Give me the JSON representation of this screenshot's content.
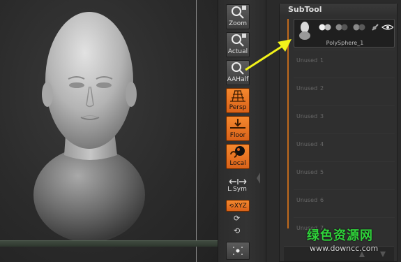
{
  "viewport": {
    "model_name": "PolySphere_1"
  },
  "shelf": {
    "zoom_label": "Zoom",
    "actual_label": "Actual",
    "aahalf_label": "AAHalf",
    "persp_label": "Persp",
    "floor_label": "Floor",
    "local_label": "Local",
    "lsym_label": "L.Sym",
    "xyz_label": "XYZ"
  },
  "subtool": {
    "title": "SubTool",
    "active_name": "PolySphere_1",
    "unused_label": "Unused",
    "slots": [
      "1",
      "2",
      "3",
      "4",
      "5",
      "6",
      "7"
    ]
  },
  "watermark": {
    "title": "绿色资源网",
    "url": "www.downcc.com"
  },
  "colors": {
    "accent_orange": "#e8741f",
    "arrow_yellow": "#f2f21a",
    "watermark_green": "#2fd23a"
  }
}
